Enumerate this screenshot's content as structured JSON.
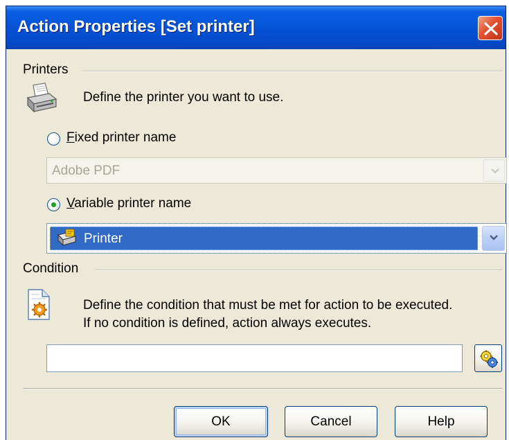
{
  "window": {
    "title": "Action Properties [Set printer]"
  },
  "printers": {
    "group_label": "Printers",
    "description": "Define the printer you want to use.",
    "fixed": {
      "label": "Fixed printer name",
      "selected": false,
      "value": "Adobe PDF",
      "enabled": false
    },
    "variable": {
      "label": "Variable printer name",
      "selected": true,
      "value": "Printer",
      "enabled": true
    }
  },
  "condition": {
    "group_label": "Condition",
    "description_line1": "Define the condition that must be met for action to be executed.",
    "description_line2": "If no condition is defined, action always executes.",
    "value": ""
  },
  "buttons": {
    "ok": "OK",
    "cancel": "Cancel",
    "help": "Help"
  },
  "icons": {
    "printer": "printer-icon",
    "condition": "condition-document-icon",
    "expression": "expression-builder-icon",
    "close": "close-icon",
    "dropdown": "chevron-down-icon",
    "variable_printer": "variable-printer-icon"
  },
  "colors": {
    "title_bar": "#0553d6",
    "close_button": "#e2502f",
    "selection": "#316ac5",
    "dialog_background": "#ece9d8"
  }
}
